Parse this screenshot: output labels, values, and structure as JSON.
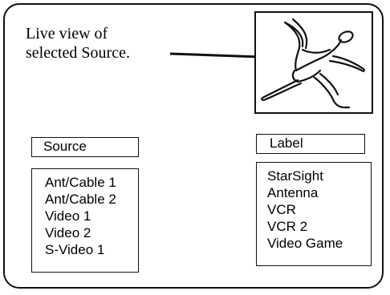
{
  "preview": {
    "caption": "Live view of\nselected Source.",
    "content_icon": "figure-skater-icon"
  },
  "source": {
    "header": "Source",
    "items": [
      "Ant/Cable 1",
      "Ant/Cable 2",
      "Video 1",
      "Video 2",
      "S-Video 1"
    ]
  },
  "label": {
    "header": "Label",
    "items": [
      "StarSight",
      "Antenna",
      "VCR",
      "VCR 2",
      "Video Game"
    ]
  }
}
